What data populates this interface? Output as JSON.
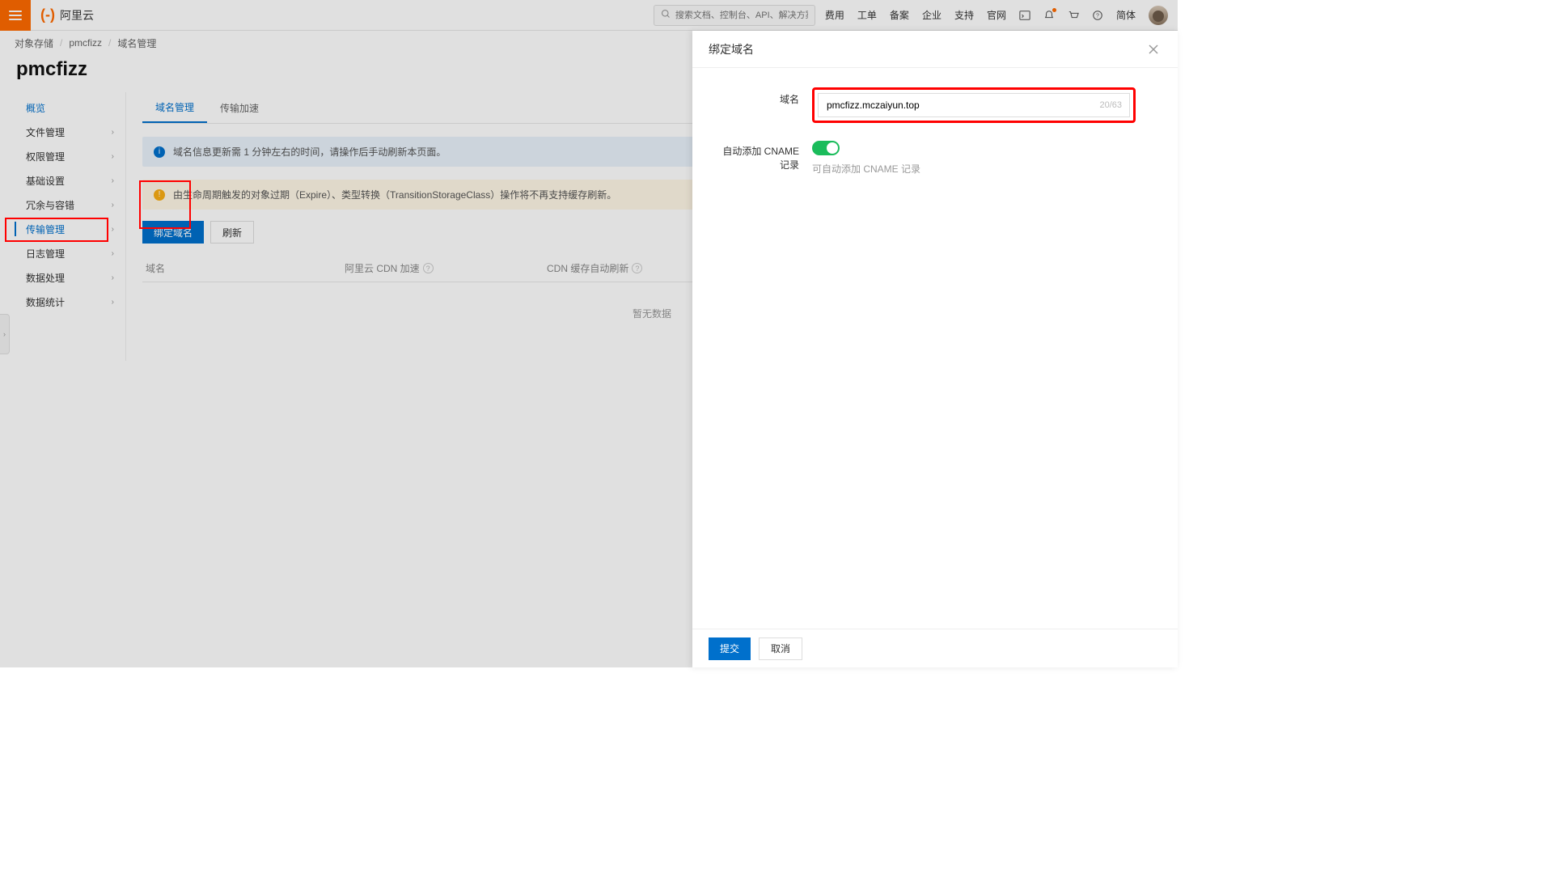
{
  "header": {
    "brand": "阿里云",
    "search_placeholder": "搜索文档、控制台、API、解决方案和资源",
    "links": [
      "费用",
      "工单",
      "备案",
      "企业",
      "支持",
      "官网"
    ],
    "simple": "简体"
  },
  "breadcrumb": {
    "items": [
      "对象存储",
      "pmcfizz",
      "域名管理"
    ]
  },
  "page_title": "pmcfizz",
  "sidenav": {
    "items": [
      {
        "label": "概览",
        "has_chevron": false,
        "active": false,
        "overview": true
      },
      {
        "label": "文件管理",
        "has_chevron": true,
        "active": false
      },
      {
        "label": "权限管理",
        "has_chevron": true,
        "active": false
      },
      {
        "label": "基础设置",
        "has_chevron": true,
        "active": false
      },
      {
        "label": "冗余与容错",
        "has_chevron": true,
        "active": false
      },
      {
        "label": "传输管理",
        "has_chevron": true,
        "active": true
      },
      {
        "label": "日志管理",
        "has_chevron": true,
        "active": false
      },
      {
        "label": "数据处理",
        "has_chevron": true,
        "active": false
      },
      {
        "label": "数据统计",
        "has_chevron": true,
        "active": false
      }
    ]
  },
  "tabs": {
    "items": [
      "域名管理",
      "传输加速"
    ],
    "active": 0
  },
  "alerts": {
    "info": "域名信息更新需 1 分钟左右的时间，请操作后手动刷新本页面。",
    "warn": "由生命周期触发的对象过期（Expire）、类型转换（TransitionStorageClass）操作将不再支持缓存刷新。"
  },
  "actions": {
    "bind": "绑定域名",
    "refresh": "刷新"
  },
  "table": {
    "col_domain": "域名",
    "col_cdn": "阿里云 CDN 加速",
    "col_refresh": "CDN 缓存自动刷新",
    "empty": "暂无数据"
  },
  "panel": {
    "title": "绑定域名",
    "label_domain": "域名",
    "domain_value": "pmcfizz.mczaiyun.top",
    "char_count": "20/63",
    "label_cname": "自动添加 CNAME 记录",
    "cname_help": "可自动添加 CNAME 记录",
    "submit": "提交",
    "cancel": "取消"
  }
}
